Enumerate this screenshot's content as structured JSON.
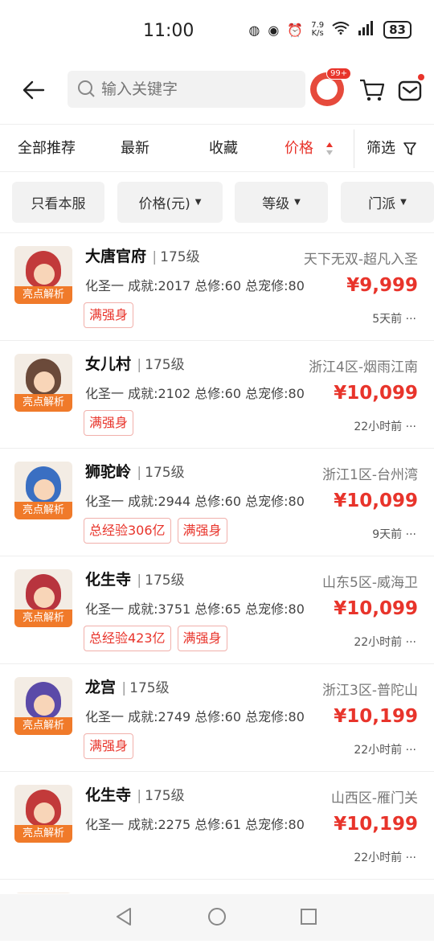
{
  "status_bar": {
    "time": "11:00",
    "netspeed_top": "7.9",
    "netspeed_unit": "K/s",
    "battery": "83"
  },
  "header": {
    "search_placeholder": "输入关键字",
    "badge": "99+"
  },
  "sort_tabs": [
    {
      "label": "全部推荐"
    },
    {
      "label": "最新"
    },
    {
      "label": "收藏"
    },
    {
      "label": "价格"
    },
    {
      "label": "筛选"
    }
  ],
  "filter_chips": [
    {
      "label": "只看本服"
    },
    {
      "label": "价格(元)"
    },
    {
      "label": "等级"
    },
    {
      "label": "门派"
    }
  ],
  "thumb_tag": "亮点解析",
  "items": [
    {
      "school": "大唐官府",
      "level": "175级",
      "server": "天下无双-超凡入圣",
      "stats": "化圣一 成就:2017 总修:60 总宠修:80",
      "price": "¥9,999",
      "tags": [
        "满强身"
      ],
      "time": "5天前"
    },
    {
      "school": "女儿村",
      "level": "175级",
      "server": "浙江4区-烟雨江南",
      "stats": "化圣一 成就:2102 总修:60 总宠修:80",
      "price": "¥10,099",
      "tags": [
        "满强身"
      ],
      "time": "22小时前"
    },
    {
      "school": "狮驼岭",
      "level": "175级",
      "server": "浙江1区-台州湾",
      "stats": "化圣一 成就:2944 总修:60 总宠修:80",
      "price": "¥10,099",
      "tags": [
        "总经验306亿",
        "满强身"
      ],
      "time": "9天前"
    },
    {
      "school": "化生寺",
      "level": "175级",
      "server": "山东5区-威海卫",
      "stats": "化圣一 成就:3751 总修:65 总宠修:80",
      "price": "¥10,099",
      "tags": [
        "总经验423亿",
        "满强身"
      ],
      "time": "22小时前"
    },
    {
      "school": "龙宫",
      "level": "175级",
      "server": "浙江3区-普陀山",
      "stats": "化圣一 成就:2749 总修:60 总宠修:80",
      "price": "¥10,199",
      "tags": [
        "满强身"
      ],
      "time": "22小时前"
    },
    {
      "school": "化生寺",
      "level": "175级",
      "server": "山西区-雁门关",
      "stats": "化圣一 成就:2275 总修:61 总宠修:80",
      "price": "¥10,199",
      "tags": [],
      "time": "22小时前"
    }
  ],
  "colors": {
    "accent": "#e8342b",
    "tag_orange": "#f07a2a"
  }
}
